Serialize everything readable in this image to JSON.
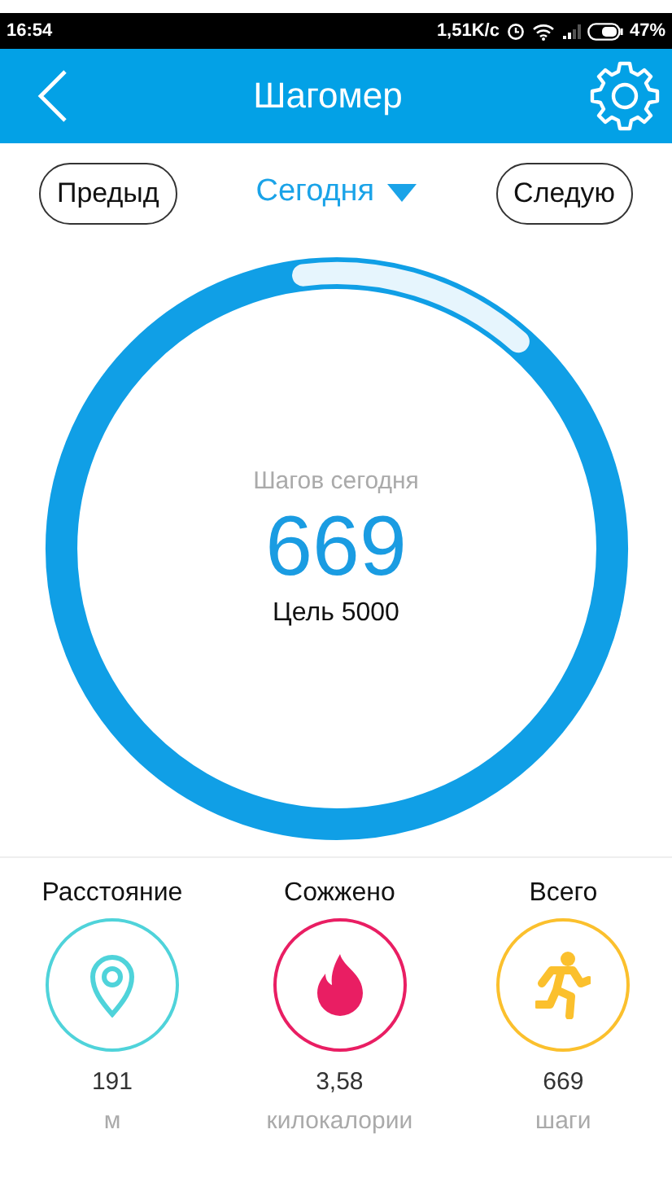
{
  "status_bar": {
    "time": "16:54",
    "speed": "1,51K/c",
    "battery": "47%"
  },
  "header": {
    "title": "Шагомер"
  },
  "nav": {
    "prev": "Предыд",
    "period": "Сегодня",
    "next": "Следую"
  },
  "progress": {
    "caption": "Шагов сегодня",
    "steps": "669",
    "goal": "Цель 5000",
    "level": 0.134
  },
  "metrics": [
    {
      "kind": "distance",
      "label": "Расстояние",
      "value": "191",
      "unit": "м",
      "color": "#4fd3da"
    },
    {
      "kind": "calories",
      "label": "Сожжено",
      "value": "3,58",
      "unit": "килокалории",
      "color": "#e91e63"
    },
    {
      "kind": "steps",
      "label": "Всего",
      "value": "669",
      "unit": "шаги",
      "color": "#fbc02d"
    }
  ]
}
